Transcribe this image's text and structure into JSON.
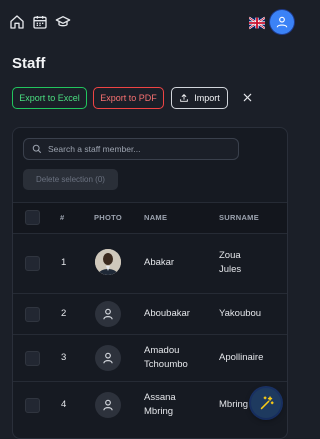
{
  "header": {
    "home_icon": "home-icon",
    "calendar_icon": "calendar-icon",
    "school_icon": "graduation-cap-icon",
    "language_flag": "uk-flag-icon",
    "user_icon": "user-icon"
  },
  "page": {
    "title": "Staff"
  },
  "actions": {
    "export_excel": "Export to Excel",
    "export_pdf": "Export to PDF",
    "import": "Import"
  },
  "search": {
    "placeholder": "Search a staff member..."
  },
  "delete_selection": "Delete selection (0)",
  "table": {
    "columns": [
      "#",
      "PHOTO",
      "NAME",
      "SURNAME"
    ],
    "rows": [
      {
        "num": "1",
        "name": "Abakar",
        "surname_line1": "Zoua",
        "surname_line2": "Jules",
        "photo": "person-photo"
      },
      {
        "num": "2",
        "name": "Aboubakar",
        "surname_line1": "Yakoubou",
        "surname_line2": "",
        "photo": "person-placeholder-icon"
      },
      {
        "num": "3",
        "name_line1": "Amadou",
        "name_line2": "Tchoumbo",
        "surname_line1": "Apollinaire",
        "surname_line2": "",
        "photo": "person-placeholder-icon"
      },
      {
        "num": "4",
        "name_line1": "Assana",
        "name_line2": "Mbring",
        "surname_line1": "Mbring",
        "surname_line2": "",
        "photo": "person-placeholder-icon"
      }
    ]
  },
  "colors": {
    "background": "#1b1f28",
    "excel": "#22c55e",
    "pdf": "#ef4444",
    "accent": "#3b82f6"
  }
}
